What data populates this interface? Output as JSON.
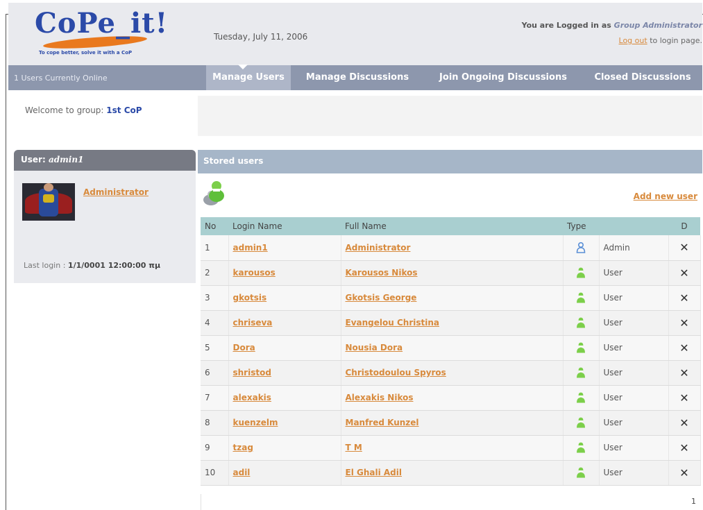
{
  "header": {
    "logo_text": "CoPe_it!",
    "logo_tagline": "To cope better, solve it with a CoP",
    "date": "Tuesday, July 11, 2006",
    "logged_in_prefix": "You are Logged in as",
    "logged_in_group": "Group Administrator",
    "logout_link": "Log out",
    "logout_suffix": "to login page."
  },
  "navbar": {
    "online_text": "1 Users Currently Online",
    "tabs": [
      {
        "label": "Manage Users",
        "active": true
      },
      {
        "label": "Manage Discussions",
        "active": false
      },
      {
        "label": "Join Ongoing Discussions",
        "active": false
      },
      {
        "label": "Closed Discussions",
        "active": false
      }
    ]
  },
  "welcome": {
    "prefix": "Welcome to group:",
    "group": "1st CoP"
  },
  "user_panel": {
    "title_prefix": "User:",
    "username": "admin1",
    "display_name": "Administrator",
    "last_login_label": "Last login :",
    "last_login_value": "1/1/0001 12:00:00 πμ"
  },
  "stored_users": {
    "title": "Stored users",
    "add_new_user": "Add new user",
    "columns": [
      "No",
      "Login Name",
      "Full Name",
      "Type",
      "",
      "D"
    ],
    "rows": [
      {
        "no": "1",
        "login": "admin1",
        "full": "Administrator",
        "type": "Admin"
      },
      {
        "no": "2",
        "login": "karousos",
        "full": "Karousos Nikos",
        "type": "User"
      },
      {
        "no": "3",
        "login": "gkotsis",
        "full": "Gkotsis George",
        "type": "User"
      },
      {
        "no": "4",
        "login": "chriseva",
        "full": "Evangelou Christina",
        "type": "User"
      },
      {
        "no": "5",
        "login": "Dora",
        "full": "Nousia Dora",
        "type": "User"
      },
      {
        "no": "6",
        "login": "shristod",
        "full": "Christodoulou Spyros",
        "type": "User"
      },
      {
        "no": "7",
        "login": "alexakis",
        "full": "Alexakis Nikos",
        "type": "User"
      },
      {
        "no": "8",
        "login": "kuenzelm",
        "full": "Manfred Kunzel",
        "type": "User"
      },
      {
        "no": "9",
        "login": "tzag",
        "full": "T M",
        "type": "User"
      },
      {
        "no": "10",
        "login": "adil",
        "full": "El Ghali Adil",
        "type": "User"
      }
    ],
    "page": "1"
  },
  "colors": {
    "accent_link": "#d88a3c",
    "navbar": "#8d97ad",
    "table_header": "#a9cfd0",
    "user_icon": "#7ccf4a",
    "admin_icon": "#5a8fd6"
  },
  "icons": {
    "user_type": "user-green-icon",
    "admin_type": "user-blue-icon",
    "delete": "delete-x-icon",
    "users_group": "users-group-icon"
  }
}
